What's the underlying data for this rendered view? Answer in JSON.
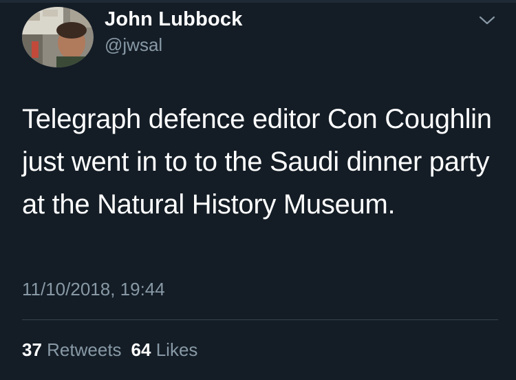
{
  "author": {
    "name": "John Lubbock",
    "handle": "@jwsal"
  },
  "tweet": {
    "text": "Telegraph defence editor Con Coughlin just went in to to the Saudi dinner party at the Natural History Museum.",
    "timestamp": "11/10/2018, 19:44"
  },
  "stats": {
    "retweets_count": "37",
    "retweets_label": "Retweets",
    "likes_count": "64",
    "likes_label": "Likes"
  },
  "colors": {
    "background": "#141d26",
    "primary_text": "#ffffff",
    "secondary_text": "#8899a6",
    "divider": "#38444d"
  },
  "icons": {
    "menu": "chevron-down-icon"
  }
}
